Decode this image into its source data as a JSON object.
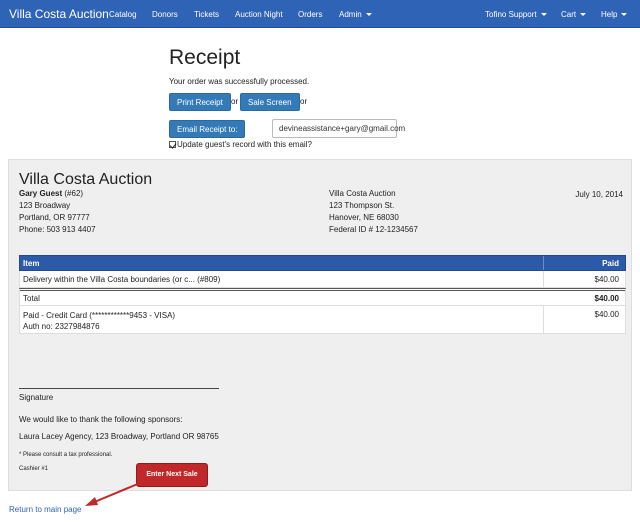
{
  "navbar": {
    "brand": "Villa Costa Auction",
    "items": [
      "Catalog",
      "Donors",
      "Tickets",
      "Auction Night",
      "Orders",
      "Admin"
    ],
    "right_items": [
      "Tofino Support",
      "Cart",
      "Help"
    ]
  },
  "receipt": {
    "title": "Receipt",
    "subtitle": "Your order was successfully processed.",
    "print_button": "Print Receipt",
    "or1": "or",
    "sale_screen_button": "Sale Screen",
    "or2": "or",
    "email_button": "Email Receipt to:",
    "email_value": "devineassistance+gary@gmail.com",
    "update_checkbox_label": "Update guest's record with this email?",
    "update_checked": true
  },
  "doc": {
    "org_name": "Villa Costa Auction",
    "guest": {
      "name": "Gary Guest",
      "number": "(#62)",
      "address1": "123 Broadway",
      "address2": "Portland, OR 97777",
      "phone": "Phone: 503 913 4407"
    },
    "org": {
      "name": "Villa Costa Auction",
      "address1": "123 Thompson St.",
      "address2": "Hanover, NE 68030",
      "federal_id": "Federal ID # 12-1234567"
    },
    "date": "July 10, 2014",
    "table": {
      "headers": [
        "Item",
        "Paid"
      ],
      "item_row": [
        "Delivery within the Villa Costa boundaries (or c... (#809)",
        "$40.00"
      ],
      "total_row": [
        "Total",
        "$40.00"
      ],
      "payment_line1": "Paid - Credit Card (************9453 - VISA)",
      "payment_line2": "Auth no: 2327984876",
      "payment_amount": "$40.00"
    },
    "signature_label": "Signature",
    "sponsors_intro": "We would like to thank the following sponsors:",
    "sponsor": "Laura Lacey Agency, 123 Broadway, Portland OR 98765",
    "tax_note": "* Please consult a tax professional.",
    "cashier": "Cashier #1"
  },
  "callout": "Enter Next Sale",
  "return_link": "Return to main page",
  "colors": {
    "navbar": "#2f63b6",
    "button": "#337ab7",
    "table_header": "#2c5aa8",
    "callout": "#c0282a",
    "panel_bg": "#efefef"
  }
}
